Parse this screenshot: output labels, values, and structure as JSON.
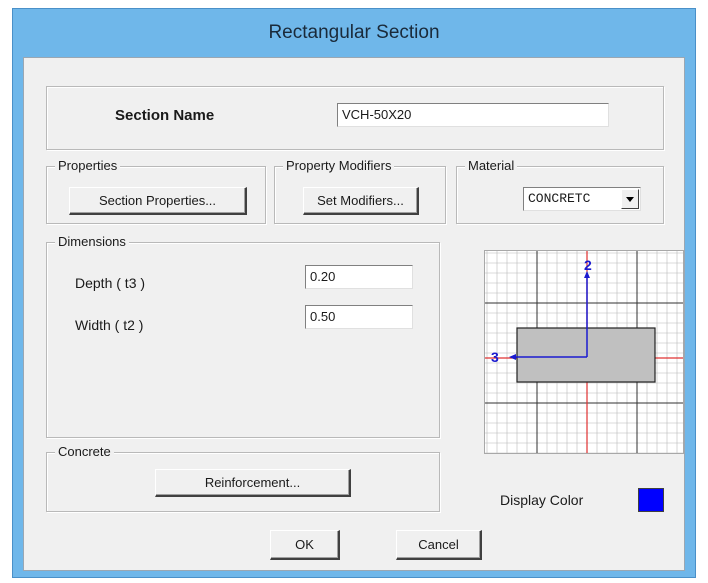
{
  "window": {
    "title": "Rectangular Section"
  },
  "section_name": {
    "label": "Section Name",
    "value": "VCH-50X20"
  },
  "properties": {
    "group_label": "Properties",
    "button_label": "Section Properties..."
  },
  "property_modifiers": {
    "group_label": "Property Modifiers",
    "button_label": "Set Modifiers..."
  },
  "material": {
    "group_label": "Material",
    "selected": "CONCRETC"
  },
  "dimensions": {
    "group_label": "Dimensions",
    "depth_label": "Depth  ( t3 )",
    "depth_value": "0.20",
    "width_label": "Width  ( t2 )",
    "width_value": "0.50"
  },
  "concrete": {
    "group_label": "Concrete",
    "button_label": "Reinforcement..."
  },
  "preview": {
    "axis_2_label": "2",
    "axis_3_label": "3",
    "section_fill": "#c0c0c0",
    "axis_color": "#1a1ad0",
    "center_line_color": "#e03030"
  },
  "display_color": {
    "label": "Display Color",
    "value": "#0000ff"
  },
  "buttons": {
    "ok": "OK",
    "cancel": "Cancel"
  }
}
